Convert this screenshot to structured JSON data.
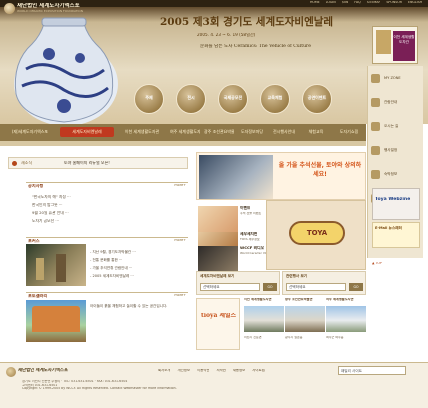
{
  "header": {
    "logo_ko": "재단법인 세계도자기엑스포",
    "logo_en": "WORLD CERAMIC EXPOSITION FOUNDATION",
    "top_nav": [
      "HOME",
      "LOGIN",
      "JOIN",
      "FAQ",
      "SITEMAP",
      "SPONSOR",
      "ENGLISH"
    ],
    "festival_title": "2005 제3회 경기도 세계도자비엔날레",
    "festival_dates": "2005. 4. 23 ~ 6. 19 (58일간)",
    "festival_subtitle": "문화를 담는 도자 Ceramics: The Vehicle of Culture",
    "circles": [
      "주제",
      "전시",
      "국제공모전",
      "교육체험",
      "공연이벤트"
    ]
  },
  "side_menu": {
    "ad_label": "이천 세계생활도자관",
    "items": [
      "MY ZONE",
      "관람안내",
      "오시는 길",
      "행사일정",
      "숙박정보",
      "관광정보"
    ]
  },
  "main_nav": {
    "items": [
      "(재)세계도자기엑스포",
      "세계도자비엔날레",
      "이천 세계생활도자관",
      "여주 세계생활도자관",
      "광주 조선관요박물관",
      "도자정보마당",
      "전시행사안내",
      "체험교육",
      "도자기쇼핑"
    ]
  },
  "notice_bar": {
    "label": "새소식",
    "value": "토야 홈페이지 리뉴얼 오픈!"
  },
  "panels": {
    "notice": {
      "title": "공지사항",
      "more": "more+",
      "items": [
        "\"한국도자의 해\" 지정 ···",
        "한국인의 밥그릇 ···",
        "9월 20일 휴관 안내 ···",
        "도자기 공모전 ···"
      ]
    },
    "news": {
      "title": "포커스",
      "more": "more+",
      "items": [
        "- 지난 9월, 경기도자박물관 ···",
        "- 전통 문화를 통한 ···",
        "- 가을 추석연휴 관람안내 ···",
        "- 2005 세계도자비엔날레 ···"
      ]
    },
    "photo": {
      "title": "포토갤러리",
      "more": "more+",
      "caption": "아이들이 흙을 체험하고 놀이할 수 있는 공간입니다."
    }
  },
  "mid": {
    "banner_text": "올 가을 추석선물, 토야와 상의하세요!",
    "mini1": {
      "title": "이벤트",
      "sub": "추석 선물 이벤트"
    },
    "mini2": {
      "title": "세무세지판",
      "sub": "TOYA 세무정보"
    },
    "mini3": {
      "title": "WCCF 비디오",
      "sub": "World Ceramic VOD"
    },
    "toya_logo": "TOYA",
    "select1": {
      "title": "세계도자비엔날레 보기",
      "value": "선택하세요",
      "button": "GO"
    },
    "select2": {
      "title": "관련행사 보기",
      "value": "선택하세요",
      "button": "GO"
    },
    "sales_text": "tioya 세일즈",
    "thumbs": [
      {
        "title": "이천 세계생활도자관",
        "sub": "이천시 신둔면"
      },
      {
        "title": "광주 조선관요박물관",
        "sub": "광주시 실촌읍"
      },
      {
        "title": "여주 세계생활도자관",
        "sub": "여주군 여주읍"
      }
    ]
  },
  "right_ads": {
    "ad1": "Toya Webzine",
    "ad2": "E-Mail 뉴스레터",
    "top": "▲ TOP"
  },
  "footer": {
    "logo": "재단법인 세계도자기엑스포",
    "links": [
      "회사소개",
      "개인정보",
      "이용약관",
      "저작권",
      "채용정보",
      "사이트맵"
    ],
    "family_select": "패밀리 사이트",
    "address": [
      "경기도 이천시 신둔면 수광리 · TEL: 031-631-6501 · FAX: 031-631-6504",
      "고객센터 031-631-6501",
      "Copyright © 1999-2005 by WCCF. All Rights Reserved. Contact Webmaster for more information."
    ]
  },
  "colors": {
    "nav_bg": "#8e7748",
    "nav_selected": "#c0391f",
    "accent_orange": "#d4551a",
    "header_dark": "#2d2212"
  }
}
